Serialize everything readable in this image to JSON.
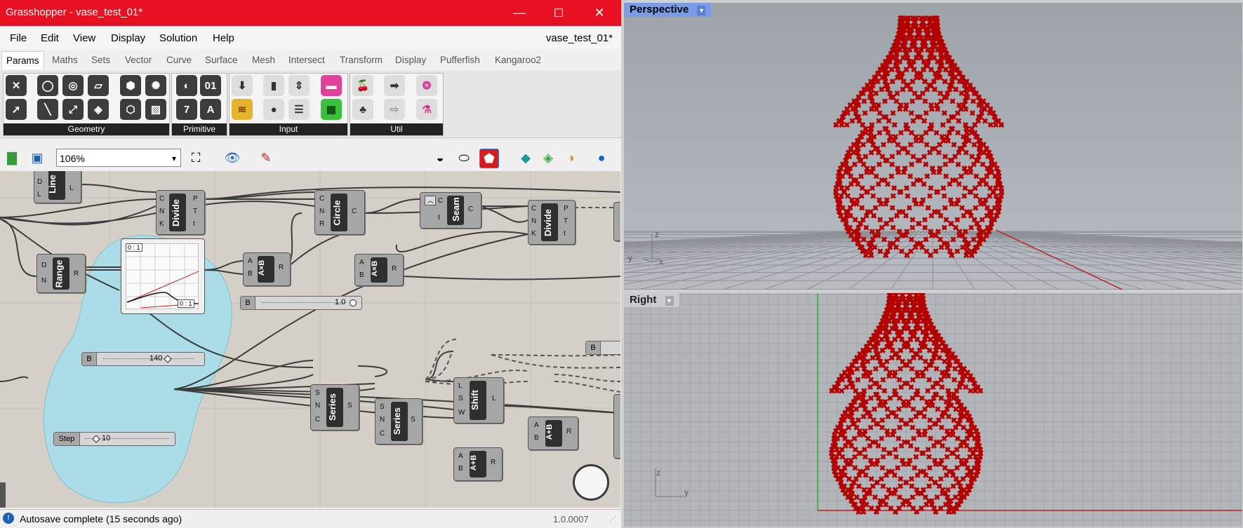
{
  "window": {
    "title": "Grasshopper - vase_test_01*",
    "doc_name": "vase_test_01*",
    "controls": {
      "minimize": "—",
      "maximize": "☐",
      "close": "✕"
    }
  },
  "menu": [
    "File",
    "Edit",
    "View",
    "Display",
    "Solution",
    "Help"
  ],
  "tabs": [
    "Params",
    "Maths",
    "Sets",
    "Vector",
    "Curve",
    "Surface",
    "Mesh",
    "Intersect",
    "Transform",
    "Display",
    "Pufferfish",
    "Kangaroo2"
  ],
  "active_tab": "Params",
  "ribbon_panels": [
    "Geometry",
    "Primitive",
    "Input",
    "Util"
  ],
  "toolbar": {
    "zoom": "106%",
    "zoom_arrow": "▾"
  },
  "canvas": {
    "components": {
      "line": {
        "name": "Line",
        "inputs": [
          "D",
          "L"
        ],
        "outputs": [
          "L"
        ]
      },
      "divide1": {
        "name": "Divide",
        "inputs": [
          "C",
          "N",
          "K"
        ],
        "outputs": [
          "P",
          "T",
          "t"
        ]
      },
      "circle": {
        "name": "Circle",
        "inputs": [
          "C",
          "N",
          "R"
        ],
        "outputs": [
          "C"
        ]
      },
      "seam": {
        "name": "Seam",
        "inputs": [
          "C",
          "t"
        ],
        "outputs": [
          "C"
        ]
      },
      "divide2": {
        "name": "Divide",
        "inputs": [
          "C",
          "N",
          "K"
        ],
        "outputs": [
          "P",
          "T",
          "t"
        ]
      },
      "range": {
        "name": "Range",
        "inputs": [
          "D",
          "N"
        ],
        "outputs": [
          "R"
        ]
      },
      "mult1": {
        "name": "A×B",
        "inputs": [
          "A",
          "B"
        ],
        "outputs": [
          "R"
        ]
      },
      "mult2": {
        "name": "A×B",
        "inputs": [
          "A",
          "B"
        ],
        "outputs": [
          "R"
        ]
      },
      "series1": {
        "name": "Series",
        "inputs": [
          "S",
          "N",
          "C"
        ],
        "outputs": [
          "S"
        ]
      },
      "series2": {
        "name": "Series",
        "inputs": [
          "S",
          "N",
          "C"
        ],
        "outputs": [
          "S"
        ]
      },
      "shift": {
        "name": "Shift",
        "inputs": [
          "L",
          "S",
          "W"
        ],
        "outputs": [
          "L"
        ]
      },
      "add1": {
        "name": "A+B",
        "inputs": [
          "A",
          "B"
        ],
        "outputs": [
          "R"
        ]
      },
      "add2": {
        "name": "A+B",
        "inputs": [
          "A",
          "B"
        ],
        "outputs": [
          "R"
        ]
      }
    },
    "graph_mapper": {
      "top_label": "0 : 1",
      "bottom_label": "0 : 1"
    },
    "sliders": {
      "b1": {
        "tag": "B",
        "value": "1.0"
      },
      "b140": {
        "tag": "B",
        "value": "140"
      },
      "step": {
        "tag": "Step",
        "value": "10"
      },
      "b_right": {
        "tag": "B"
      }
    }
  },
  "status": {
    "message": "Autosave complete (15 seconds ago)",
    "version": "1.0.0007"
  },
  "viewports": {
    "perspective": {
      "label": "Perspective",
      "axis_z": "z",
      "axis_x": "x",
      "axis_y": "y"
    },
    "right": {
      "label": "Right",
      "axis_z": "z",
      "axis_y": "y"
    }
  },
  "colors": {
    "titlebar": "#e81123",
    "point_cloud": "#b30000",
    "blob": "#aadde8"
  }
}
